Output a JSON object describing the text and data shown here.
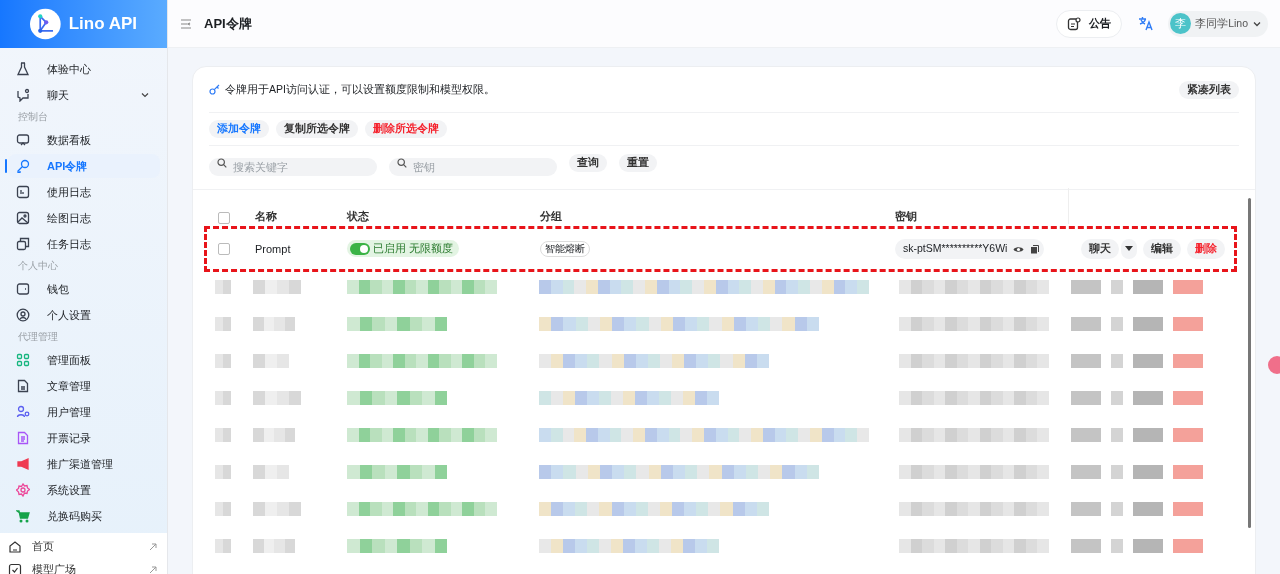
{
  "brand": {
    "name": "Lino API"
  },
  "header": {
    "title": "API令牌",
    "notice_button": "公告",
    "user": {
      "avatar": "李",
      "name": "李同学Lino"
    }
  },
  "sidebar": {
    "items": [
      {
        "kind": "item",
        "label": "体验中心",
        "selected": false
      },
      {
        "kind": "item",
        "label": "聊天",
        "selected": false,
        "expanded": false
      },
      {
        "kind": "section",
        "label": "控制台"
      },
      {
        "kind": "item",
        "label": "数据看板",
        "selected": false
      },
      {
        "kind": "item",
        "label": "API令牌",
        "selected": true
      },
      {
        "kind": "item",
        "label": "使用日志",
        "selected": false
      },
      {
        "kind": "item",
        "label": "绘图日志",
        "selected": false
      },
      {
        "kind": "item",
        "label": "任务日志",
        "selected": false
      },
      {
        "kind": "section",
        "label": "个人中心"
      },
      {
        "kind": "item",
        "label": "钱包",
        "selected": false
      },
      {
        "kind": "item",
        "label": "个人设置",
        "selected": false
      },
      {
        "kind": "section",
        "label": "代理管理"
      },
      {
        "kind": "item",
        "label": "管理面板",
        "selected": false,
        "color": "#16b67f"
      },
      {
        "kind": "item",
        "label": "文章管理",
        "selected": false
      },
      {
        "kind": "item",
        "label": "用户管理",
        "selected": false,
        "color": "#5b5ff0"
      },
      {
        "kind": "item",
        "label": "开票记录",
        "selected": false,
        "color": "#a855f7"
      },
      {
        "kind": "item",
        "label": "推广渠道管理",
        "selected": false,
        "color": "#ef3b52"
      },
      {
        "kind": "item",
        "label": "系统设置",
        "selected": false,
        "color": "#ec4899"
      },
      {
        "kind": "item",
        "label": "兑换码购买",
        "selected": false,
        "color": "#16a34a"
      }
    ],
    "footer": [
      {
        "label": "首页"
      },
      {
        "label": "模型广场"
      }
    ]
  },
  "card": {
    "description": "令牌用于API访问认证，可以设置额度限制和模型权限。",
    "compact_button": "紧凑列表",
    "actions": [
      {
        "label": "添加令牌",
        "kind": "primary"
      },
      {
        "label": "复制所选令牌",
        "kind": "normal"
      },
      {
        "label": "删除所选令牌",
        "kind": "danger"
      }
    ],
    "filters": [
      {
        "placeholder": "搜索关键字"
      },
      {
        "placeholder": "密钥"
      }
    ],
    "filter_buttons": [
      "查询",
      "重置"
    ]
  },
  "table": {
    "all_checked": false,
    "columns": [
      "名称",
      "状态",
      "分组",
      "密钥"
    ],
    "rows": [
      {
        "checked": false,
        "name": "Prompt",
        "enabled": true,
        "status": "已启用",
        "quota": "无限额度",
        "group": "智能熔断",
        "key": "sk-ptSM**********Y6Wi",
        "actions": [
          "聊天",
          "编辑",
          "删除"
        ],
        "highlighted": true
      }
    ],
    "redacted_rows": [
      {
        "kind": "redacted"
      },
      {
        "kind": "redacted"
      },
      {
        "kind": "redacted"
      },
      {
        "kind": "redacted"
      },
      {
        "kind": "redacted"
      },
      {
        "kind": "redacted"
      },
      {
        "kind": "redacted"
      },
      {
        "kind": "redacted"
      }
    ]
  }
}
